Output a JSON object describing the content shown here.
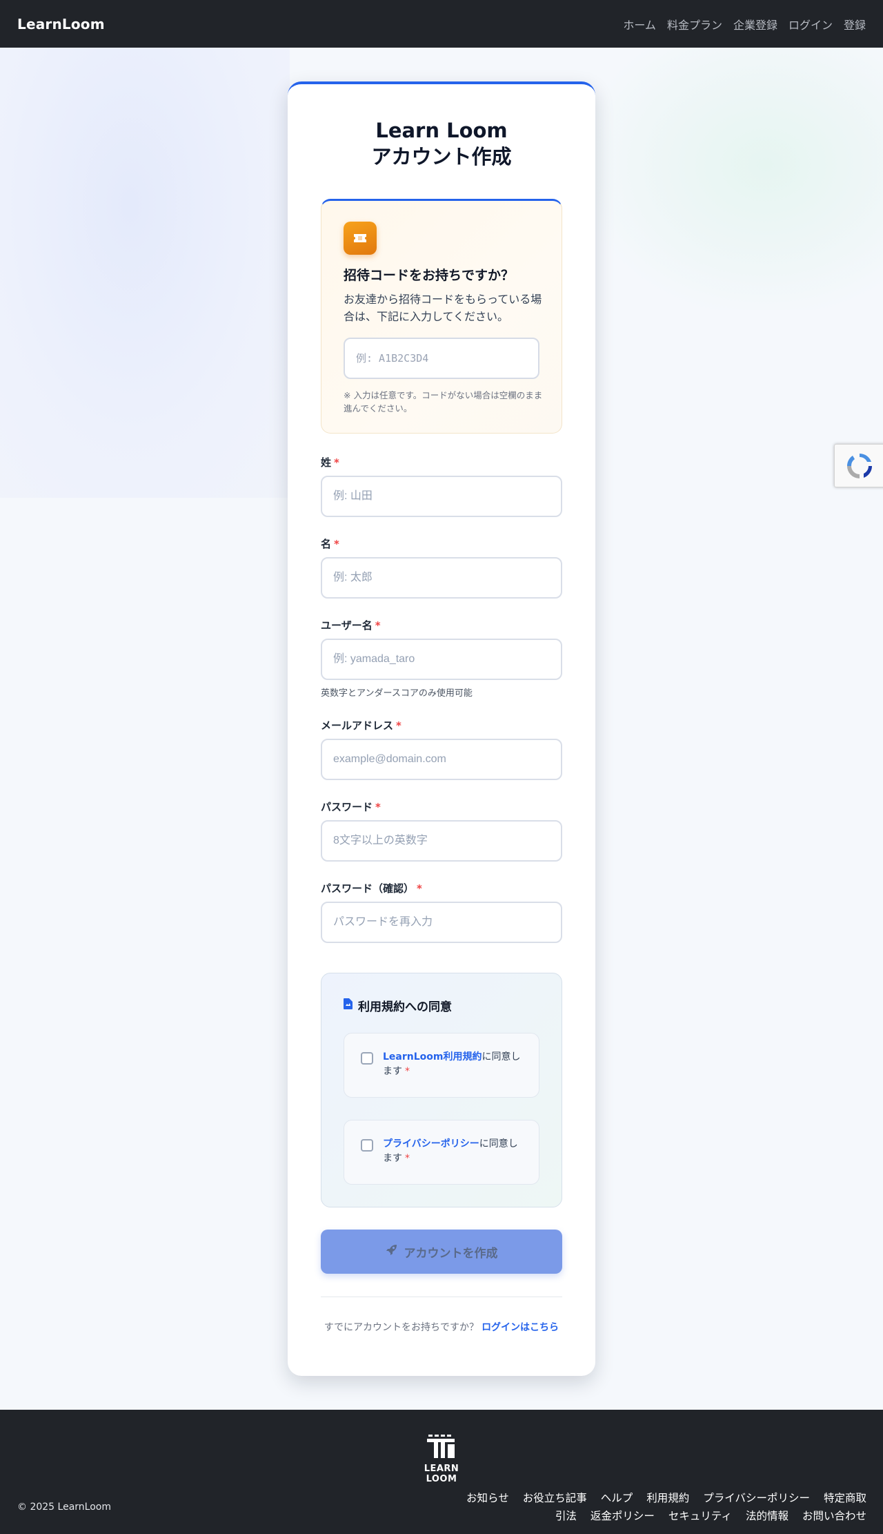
{
  "header": {
    "brand": "LearnLoom",
    "nav": [
      "ホーム",
      "料金プラン",
      "企業登録",
      "ログイン",
      "登録"
    ]
  },
  "card": {
    "title_line1": "Learn Loom",
    "title_line2": "アカウント作成"
  },
  "invite": {
    "icon": "ticket-icon",
    "heading": "招待コードをお持ちですか？",
    "description": "お友達から招待コードをもらっている場合は、下記に入力してください。",
    "placeholder": "例: A1B2C3D4",
    "note": "※ 入力は任意です。コードがない場合は空欄のまま進んでください。"
  },
  "fields": {
    "last_name": {
      "label": "姓",
      "placeholder": "例: 山田"
    },
    "first_name": {
      "label": "名",
      "placeholder": "例: 太郎"
    },
    "username": {
      "label": "ユーザー名",
      "placeholder": "例: yamada_taro",
      "hint": "英数字とアンダースコアのみ使用可能"
    },
    "email": {
      "label": "メールアドレス",
      "placeholder": "example@domain.com"
    },
    "password": {
      "label": "パスワード",
      "placeholder": "8文字以上の英数字"
    },
    "password_confirm": {
      "label": "パスワード（確認）",
      "placeholder": "パスワードを再入力"
    },
    "required_mark": "*"
  },
  "terms": {
    "heading": "利用規約への同意",
    "tos_link": "LearnLoom利用規約",
    "tos_suffix": "に同意します",
    "privacy_link": "プライバシーポリシー",
    "privacy_suffix": "に同意します"
  },
  "submit": {
    "label": "アカウントを作成"
  },
  "login": {
    "prompt": "すでにアカウントをお持ちですか？",
    "link": "ログインはこちら"
  },
  "footer": {
    "logo_text": "LEARN LOOM",
    "copyright": "© 2025 LearnLoom",
    "links_row1": [
      "お知らせ",
      "お役立ち記事",
      "ヘルプ",
      "利用規約",
      "プライバシーポリシー",
      "特定商取"
    ],
    "links_row2": [
      "引法",
      "返金ポリシー",
      "セキュリティ",
      "法的情報",
      "お問い合わせ"
    ]
  },
  "colors": {
    "accent": "#2563eb",
    "header_bg": "#212429",
    "required": "#ef4444",
    "invite_icon": "#f39c12",
    "submit_disabled": "#7b9ae8"
  }
}
